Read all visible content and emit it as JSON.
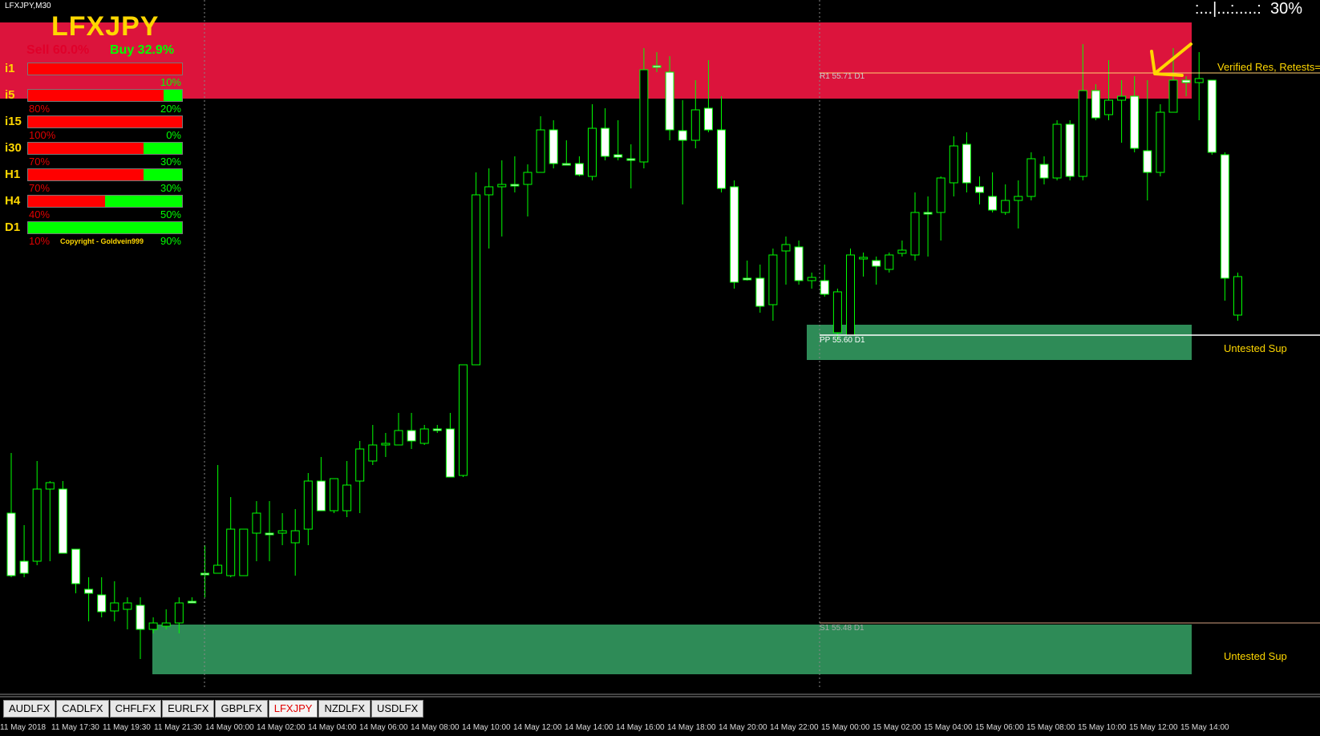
{
  "window": {
    "title": "LFXJPY,M30"
  },
  "panel": {
    "symbol": "LFXJPY",
    "sell_label": "Sell 60.0%",
    "buy_label": "Buy 32.9%",
    "copyright": "Copyright - Goldvein999",
    "timeframes": [
      {
        "label": "i1",
        "sell_pct": "",
        "buy_pct": "10%",
        "buy_fraction": 0.0
      },
      {
        "label": "i5",
        "sell_pct": "80%",
        "buy_pct": "20%",
        "buy_fraction": 0.12
      },
      {
        "label": "i15",
        "sell_pct": "100%",
        "buy_pct": "0%",
        "buy_fraction": 0.0
      },
      {
        "label": "i30",
        "sell_pct": "70%",
        "buy_pct": "30%",
        "buy_fraction": 0.25
      },
      {
        "label": "H1",
        "sell_pct": "70%",
        "buy_pct": "30%",
        "buy_fraction": 0.25
      },
      {
        "label": "H4",
        "sell_pct": "40%",
        "buy_pct": "50%",
        "buy_fraction": 0.5
      },
      {
        "label": "D1",
        "sell_pct": "10%",
        "buy_pct": "90%",
        "buy_fraction": 1.0
      }
    ]
  },
  "strength": {
    "dots": ":...|...:.....:",
    "value": "30%"
  },
  "levels": {
    "r1": "R1 55.71 D1",
    "pp": "PP 55.60 D1",
    "s1": "S1 55.48 D1"
  },
  "zones": {
    "resistance_label": "Verified Res, Retests=",
    "support_label_1": "Untested Sup",
    "support_label_2": "Untested Sup"
  },
  "colors": {
    "resistance_zone": "#dc143c",
    "support_zone": "#2e8b57",
    "candle_outline": "#00ff00",
    "bull_body": "#000000",
    "bear_body": "#ffffff",
    "arrow": "#ffd700"
  },
  "tabs": [
    "AUDLFX",
    "CADLFX",
    "CHFLFX",
    "EURLFX",
    "GBPLFX",
    "LFXJPY",
    "NZDLFX",
    "USDLFX"
  ],
  "active_tab": "LFXJPY",
  "time_axis": [
    "11 May 2018",
    "11 May 17:30",
    "11 May 19:30",
    "11 May 21:30",
    "14 May 00:00",
    "14 May 02:00",
    "14 May 04:00",
    "14 May 06:00",
    "14 May 08:00",
    "14 May 10:00",
    "14 May 12:00",
    "14 May 14:00",
    "14 May 16:00",
    "14 May 18:00",
    "14 May 20:00",
    "14 May 22:00",
    "15 May 00:00",
    "15 May 02:00",
    "15 May 04:00",
    "15 May 06:00",
    "15 May 08:00",
    "15 May 10:00",
    "15 May 12:00",
    "15 May 14:00"
  ],
  "chart_data": {
    "type": "candlestick",
    "series": [
      {
        "o": 640,
        "h": 565,
        "l": 720,
        "c": 718
      },
      {
        "o": 700,
        "h": 655,
        "l": 720,
        "c": 715
      },
      {
        "o": 700,
        "h": 575,
        "l": 705,
        "c": 610
      },
      {
        "o": 610,
        "h": 600,
        "l": 700,
        "c": 602
      },
      {
        "o": 610,
        "h": 600,
        "l": 690,
        "c": 690
      },
      {
        "o": 685,
        "h": 685,
        "l": 740,
        "c": 728
      },
      {
        "o": 735,
        "h": 720,
        "l": 775,
        "c": 740
      },
      {
        "o": 742,
        "h": 720,
        "l": 770,
        "c": 763
      },
      {
        "o": 762,
        "h": 725,
        "l": 775,
        "c": 752
      },
      {
        "o": 760,
        "h": 745,
        "l": 785,
        "c": 752
      },
      {
        "o": 755,
        "h": 745,
        "l": 822,
        "c": 785
      },
      {
        "o": 785,
        "h": 770,
        "l": 790,
        "c": 777
      },
      {
        "o": 781,
        "h": 760,
        "l": 785,
        "c": 777
      },
      {
        "o": 777,
        "h": 745,
        "l": 790,
        "c": 752
      },
      {
        "o": 750,
        "h": 745,
        "l": 750,
        "c": 750
      },
      {
        "o": 715,
        "h": 680,
        "l": 745,
        "c": 715
      },
      {
        "o": 715,
        "h": 580,
        "l": 715,
        "c": 705
      },
      {
        "o": 718,
        "h": 620,
        "l": 720,
        "c": 660
      },
      {
        "o": 718,
        "h": 660,
        "l": 718,
        "c": 660
      },
      {
        "o": 665,
        "h": 625,
        "l": 700,
        "c": 640
      },
      {
        "o": 665,
        "h": 625,
        "l": 700,
        "c": 665
      },
      {
        "o": 665,
        "h": 640,
        "l": 680,
        "c": 662
      },
      {
        "o": 677,
        "h": 635,
        "l": 718,
        "c": 662
      },
      {
        "o": 660,
        "h": 590,
        "l": 680,
        "c": 600
      },
      {
        "o": 600,
        "h": 570,
        "l": 605,
        "c": 637
      },
      {
        "o": 637,
        "h": 600,
        "l": 640,
        "c": 597
      },
      {
        "o": 637,
        "h": 575,
        "l": 645,
        "c": 605
      },
      {
        "o": 600,
        "h": 550,
        "l": 640,
        "c": 560
      },
      {
        "o": 575,
        "h": 530,
        "l": 580,
        "c": 555
      },
      {
        "o": 555,
        "h": 540,
        "l": 570,
        "c": 553
      },
      {
        "o": 555,
        "h": 515,
        "l": 555,
        "c": 537
      },
      {
        "o": 537,
        "h": 515,
        "l": 560,
        "c": 550
      },
      {
        "o": 553,
        "h": 530,
        "l": 555,
        "c": 535
      },
      {
        "o": 535,
        "h": 530,
        "l": 540,
        "c": 535
      },
      {
        "o": 535,
        "h": 515,
        "l": 560,
        "c": 595
      },
      {
        "o": 593,
        "h": 455,
        "l": 595,
        "c": 455
      },
      {
        "o": 455,
        "h": 215,
        "l": 455,
        "c": 243
      },
      {
        "o": 243,
        "h": 210,
        "l": 310,
        "c": 233
      },
      {
        "o": 233,
        "h": 200,
        "l": 295,
        "c": 230
      },
      {
        "o": 230,
        "h": 195,
        "l": 240,
        "c": 230
      },
      {
        "o": 230,
        "h": 205,
        "l": 270,
        "c": 215
      },
      {
        "o": 215,
        "h": 145,
        "l": 215,
        "c": 162
      },
      {
        "o": 162,
        "h": 150,
        "l": 210,
        "c": 204
      },
      {
        "o": 204,
        "h": 175,
        "l": 205,
        "c": 205
      },
      {
        "o": 204,
        "h": 195,
        "l": 220,
        "c": 218
      },
      {
        "o": 220,
        "h": 130,
        "l": 225,
        "c": 160
      },
      {
        "o": 160,
        "h": 135,
        "l": 200,
        "c": 195
      },
      {
        "o": 193,
        "h": 150,
        "l": 200,
        "c": 196
      },
      {
        "o": 198,
        "h": 180,
        "l": 235,
        "c": 198
      },
      {
        "o": 202,
        "h": 60,
        "l": 210,
        "c": 87
      },
      {
        "o": 82,
        "h": 65,
        "l": 90,
        "c": 82
      },
      {
        "o": 90,
        "h": 70,
        "l": 175,
        "c": 162
      },
      {
        "o": 163,
        "h": 125,
        "l": 255,
        "c": 175
      },
      {
        "o": 175,
        "h": 100,
        "l": 185,
        "c": 137
      },
      {
        "o": 135,
        "h": 75,
        "l": 165,
        "c": 162
      },
      {
        "o": 162,
        "h": 120,
        "l": 240,
        "c": 235
      },
      {
        "o": 233,
        "h": 225,
        "l": 360,
        "c": 352
      },
      {
        "o": 347,
        "h": 325,
        "l": 350,
        "c": 347
      },
      {
        "o": 347,
        "h": 330,
        "l": 390,
        "c": 382
      },
      {
        "o": 380,
        "h": 310,
        "l": 400,
        "c": 318
      },
      {
        "o": 313,
        "h": 295,
        "l": 355,
        "c": 305
      },
      {
        "o": 308,
        "h": 300,
        "l": 355,
        "c": 350
      },
      {
        "o": 350,
        "h": 340,
        "l": 360,
        "c": 346
      },
      {
        "o": 350,
        "h": 330,
        "l": 370,
        "c": 367
      },
      {
        "o": 415,
        "h": 360,
        "l": 425,
        "c": 364
      },
      {
        "o": 418,
        "h": 310,
        "l": 418,
        "c": 318
      },
      {
        "o": 323,
        "h": 315,
        "l": 345,
        "c": 321
      },
      {
        "o": 325,
        "h": 320,
        "l": 355,
        "c": 332
      },
      {
        "o": 336,
        "h": 315,
        "l": 340,
        "c": 318
      },
      {
        "o": 316,
        "h": 300,
        "l": 320,
        "c": 312
      },
      {
        "o": 318,
        "h": 240,
        "l": 325,
        "c": 265
      },
      {
        "o": 265,
        "h": 245,
        "l": 320,
        "c": 265
      },
      {
        "o": 265,
        "h": 220,
        "l": 300,
        "c": 222
      },
      {
        "o": 228,
        "h": 170,
        "l": 245,
        "c": 182
      },
      {
        "o": 180,
        "h": 165,
        "l": 240,
        "c": 228
      },
      {
        "o": 233,
        "h": 220,
        "l": 255,
        "c": 240
      },
      {
        "o": 245,
        "h": 215,
        "l": 265,
        "c": 262
      },
      {
        "o": 265,
        "h": 230,
        "l": 268,
        "c": 250
      },
      {
        "o": 250,
        "h": 225,
        "l": 285,
        "c": 245
      },
      {
        "o": 245,
        "h": 190,
        "l": 250,
        "c": 198
      },
      {
        "o": 205,
        "h": 195,
        "l": 230,
        "c": 222
      },
      {
        "o": 222,
        "h": 150,
        "l": 225,
        "c": 155
      },
      {
        "o": 155,
        "h": 150,
        "l": 225,
        "c": 220
      },
      {
        "o": 220,
        "h": 55,
        "l": 225,
        "c": 113
      },
      {
        "o": 113,
        "h": 105,
        "l": 150,
        "c": 147
      },
      {
        "o": 143,
        "h": 75,
        "l": 150,
        "c": 125
      },
      {
        "o": 125,
        "h": 100,
        "l": 178,
        "c": 120
      },
      {
        "o": 120,
        "h": 95,
        "l": 190,
        "c": 185
      },
      {
        "o": 188,
        "h": 100,
        "l": 250,
        "c": 215
      },
      {
        "o": 215,
        "h": 130,
        "l": 220,
        "c": 140
      },
      {
        "o": 140,
        "h": 60,
        "l": 140,
        "c": 100
      },
      {
        "o": 100,
        "h": 95,
        "l": 120,
        "c": 103
      },
      {
        "o": 103,
        "h": 65,
        "l": 150,
        "c": 98
      },
      {
        "o": 100,
        "h": 100,
        "l": 193,
        "c": 190
      },
      {
        "o": 193,
        "h": 190,
        "l": 375,
        "c": 347
      },
      {
        "o": 393,
        "h": 340,
        "l": 400,
        "c": 345
      }
    ]
  }
}
